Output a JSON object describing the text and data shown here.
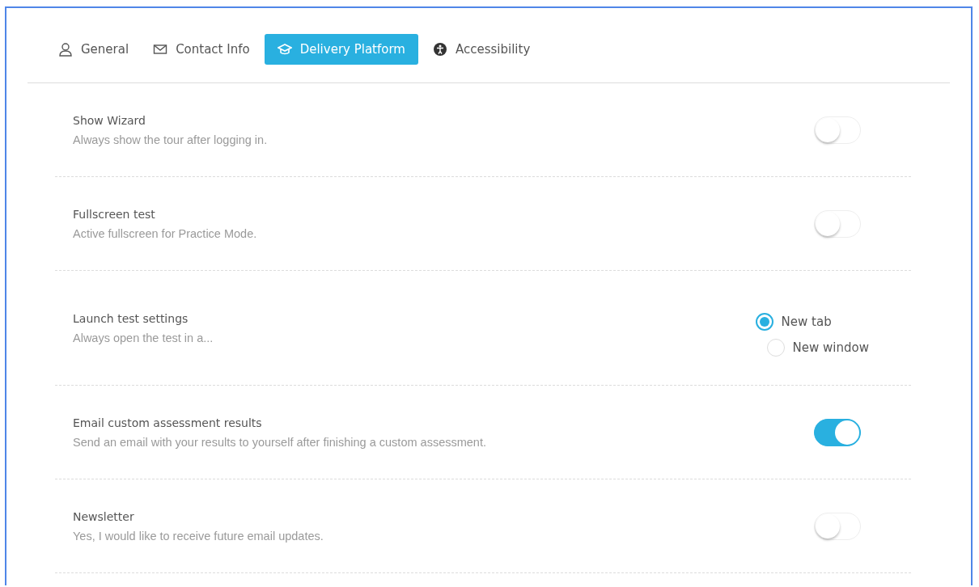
{
  "tabs": [
    {
      "label": "General",
      "kind": "user",
      "selected": false
    },
    {
      "label": "Contact Info",
      "kind": "mail",
      "selected": false
    },
    {
      "label": "Delivery Platform",
      "kind": "cap",
      "selected": true
    },
    {
      "label": "Accessibility",
      "kind": "access",
      "selected": false
    }
  ],
  "settings": [
    {
      "kind": "toggle",
      "title": "Show Wizard",
      "description": "Always show the tour after logging in.",
      "on": false
    },
    {
      "kind": "toggle",
      "title": "Fullscreen test",
      "description": "Active fullscreen for Practice Mode.",
      "on": false
    },
    {
      "kind": "radio",
      "title": "Launch test settings",
      "description": "Always open the test in a...",
      "options": [
        {
          "label": "New tab",
          "selected": true
        },
        {
          "label": "New window",
          "selected": false
        }
      ]
    },
    {
      "kind": "toggle",
      "title": "Email custom assessment results",
      "description": "Send an email with your results to yourself after finishing a custom assessment.",
      "on": true
    },
    {
      "kind": "toggle",
      "title": "Newsletter",
      "description": "Yes, I would like to receive future email updates.",
      "on": false
    }
  ]
}
